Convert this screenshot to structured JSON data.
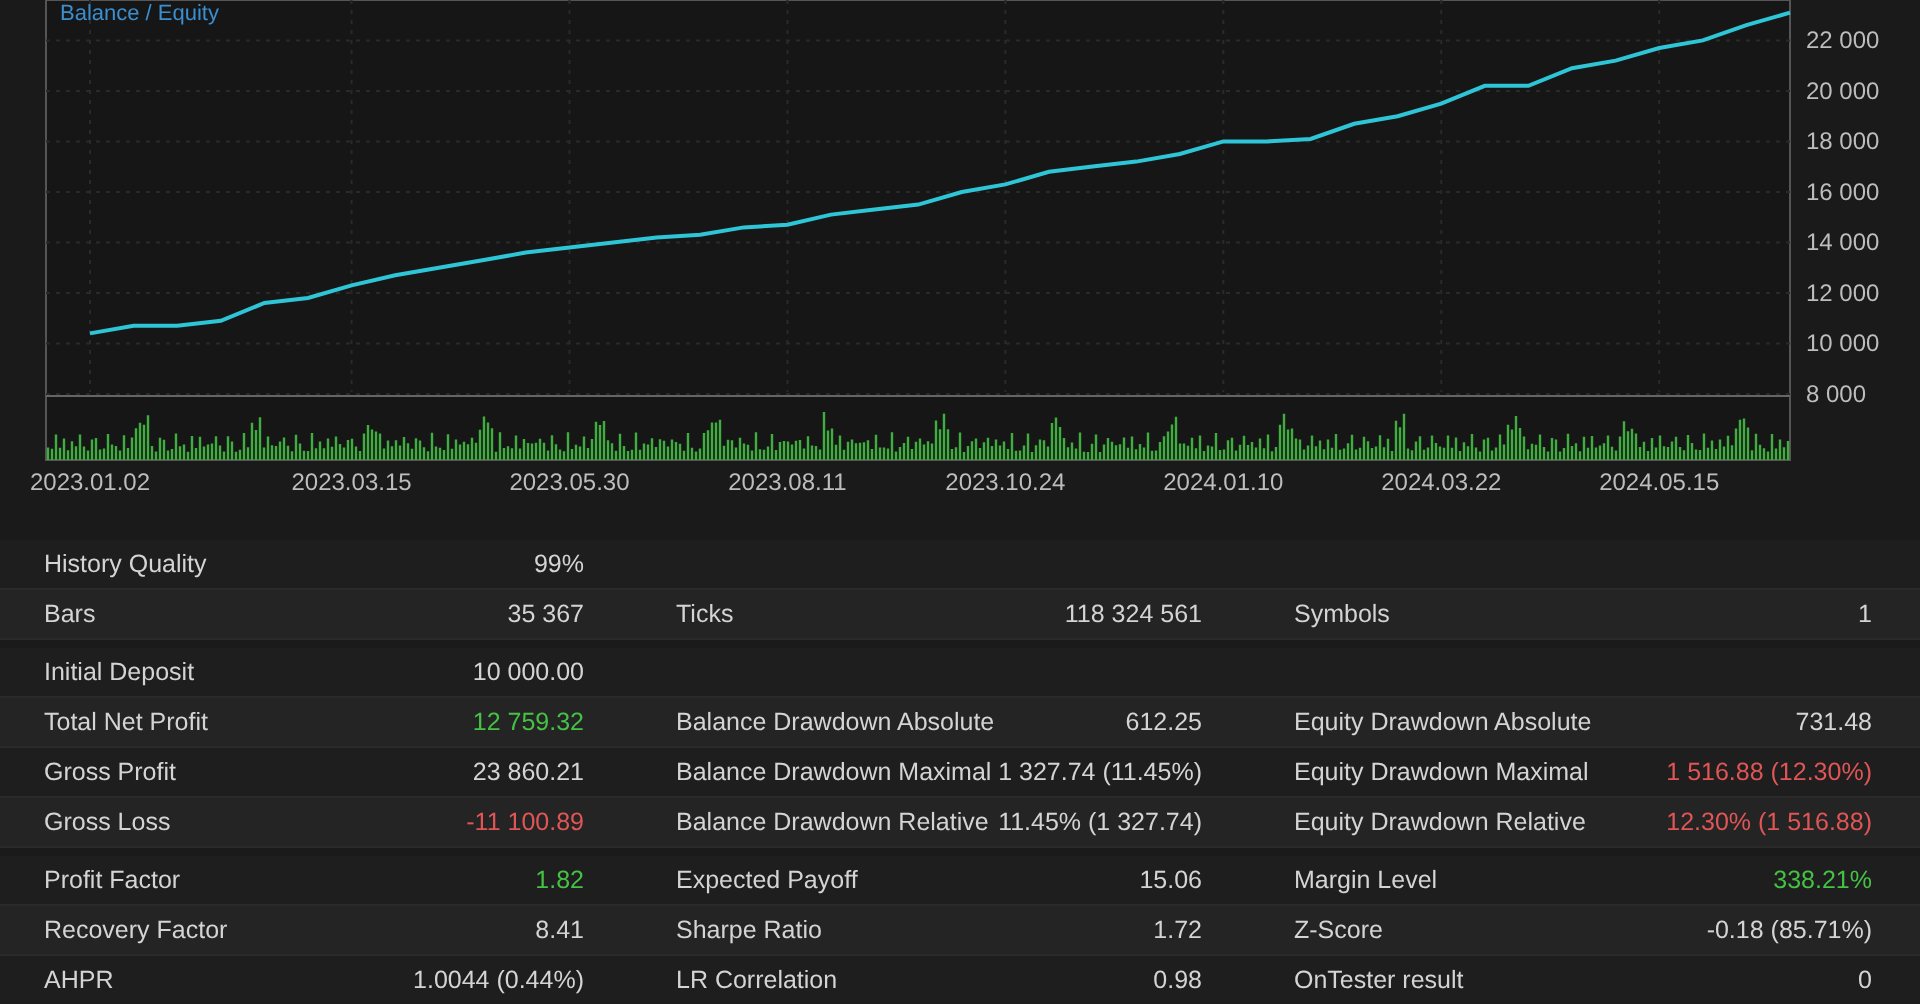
{
  "chart": {
    "chart_data": {
      "type": "line",
      "title": "Balance / Equity",
      "categories": [
        "2023.01.02",
        null,
        null,
        null,
        null,
        null,
        "2023.03.15",
        null,
        null,
        null,
        null,
        "2023.05.30",
        null,
        null,
        null,
        null,
        "2023.08.11",
        null,
        null,
        null,
        null,
        "2023.10.24",
        null,
        null,
        null,
        null,
        "2024.01.10",
        null,
        null,
        null,
        null,
        "2024.03.22",
        null,
        null,
        null,
        null,
        "2024.05.15",
        null,
        null,
        null
      ],
      "series": [
        {
          "color": "#2ec5d6",
          "values": [
            10400,
            10700,
            10700,
            10900,
            11600,
            11800,
            12300,
            12700,
            13000,
            13300,
            13600,
            13800,
            14000,
            14200,
            14300,
            14600,
            14700,
            15100,
            15300,
            15500,
            16000,
            16300,
            16800,
            17000,
            17200,
            17500,
            18000,
            18000,
            18100,
            18700,
            19000,
            19500,
            20200,
            20200,
            20900,
            21200,
            21700,
            22000,
            22600,
            23100
          ]
        }
      ],
      "ylim": [
        8000,
        23600
      ],
      "grid": true,
      "yticks": [
        {
          "value": 8000,
          "label": "8 000"
        },
        {
          "value": 10000,
          "label": "10 000"
        },
        {
          "value": 12000,
          "label": "12 000"
        },
        {
          "value": 14000,
          "label": "14 000"
        },
        {
          "value": 16000,
          "label": "16 000"
        },
        {
          "value": 18000,
          "label": "18 000"
        },
        {
          "value": 20000,
          "label": "20 000"
        },
        {
          "value": 22000,
          "label": "22 000"
        }
      ]
    }
  },
  "stats": {
    "groups": [
      {
        "rows": [
          {
            "cells": [
              {
                "label": "History Quality",
                "value": "99%"
              }
            ]
          },
          {
            "cells": [
              {
                "label": "Bars",
                "value": "35 367"
              },
              {
                "label": "Ticks",
                "value": "118 324 561"
              },
              {
                "label": "Symbols",
                "value": "1"
              }
            ]
          }
        ]
      },
      {
        "rows": [
          {
            "cells": [
              {
                "label": "Initial Deposit",
                "value": "10 000.00"
              }
            ]
          },
          {
            "cells": [
              {
                "label": "Total Net Profit",
                "value": "12 759.32",
                "color": "#45c245"
              },
              {
                "label": "Balance Drawdown Absolute",
                "value": "612.25"
              },
              {
                "label": "Equity Drawdown Absolute",
                "value": "731.48"
              }
            ]
          },
          {
            "cells": [
              {
                "label": "Gross Profit",
                "value": "23 860.21"
              },
              {
                "label": "Balance Drawdown Maximal",
                "value": "1 327.74 (11.45%)"
              },
              {
                "label": "Equity Drawdown Maximal",
                "value": "1 516.88 (12.30%)",
                "color": "#e05555"
              }
            ]
          },
          {
            "cells": [
              {
                "label": "Gross Loss",
                "value": "-11 100.89",
                "color": "#e05555"
              },
              {
                "label": "Balance Drawdown Relative",
                "value": "11.45% (1 327.74)"
              },
              {
                "label": "Equity Drawdown Relative",
                "value": "12.30% (1 516.88)",
                "color": "#e05555"
              }
            ]
          }
        ]
      },
      {
        "rows": [
          {
            "cells": [
              {
                "label": "Profit Factor",
                "value": "1.82",
                "color": "#45c245"
              },
              {
                "label": "Expected Payoff",
                "value": "15.06"
              },
              {
                "label": "Margin Level",
                "value": "338.21%",
                "color": "#45c245"
              }
            ]
          },
          {
            "cells": [
              {
                "label": "Recovery Factor",
                "value": "8.41"
              },
              {
                "label": "Sharpe Ratio",
                "value": "1.72"
              },
              {
                "label": "Z-Score",
                "value": "-0.18 (85.71%)"
              }
            ]
          },
          {
            "cells": [
              {
                "label": "AHPR",
                "value": "1.0044 (0.44%)"
              },
              {
                "label": "LR Correlation",
                "value": "0.98"
              },
              {
                "label": "OnTester result",
                "value": "0"
              }
            ]
          }
        ]
      }
    ]
  }
}
